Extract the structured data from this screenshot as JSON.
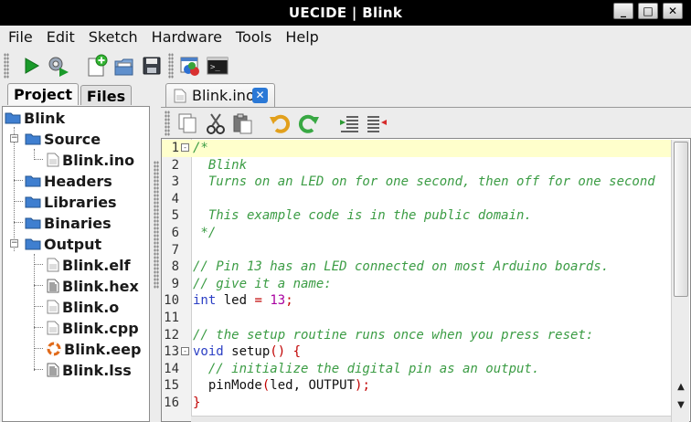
{
  "window": {
    "title": "UECIDE | Blink",
    "min_glyph": "_",
    "max_glyph": "□",
    "close_glyph": "✕"
  },
  "menu": [
    "File",
    "Edit",
    "Sketch",
    "Hardware",
    "Tools",
    "Help"
  ],
  "toolbar_icons": [
    "run-icon",
    "program-icon",
    "new-file-icon",
    "open-file-icon",
    "save-icon",
    "board-manager-icon",
    "serial-terminal-icon"
  ],
  "left_tabs": {
    "project": "Project",
    "files": "Files"
  },
  "tree": [
    {
      "label": "Blink",
      "icon": "folder-icon"
    },
    {
      "label": "Source",
      "icon": "folder-icon"
    },
    {
      "label": "Blink.ino",
      "icon": "file-icon"
    },
    {
      "label": "Headers",
      "icon": "folder-icon"
    },
    {
      "label": "Libraries",
      "icon": "folder-icon"
    },
    {
      "label": "Binaries",
      "icon": "folder-icon"
    },
    {
      "label": "Output",
      "icon": "folder-icon"
    },
    {
      "label": "Blink.elf",
      "icon": "file-icon"
    },
    {
      "label": "Blink.hex",
      "icon": "hex-file-icon"
    },
    {
      "label": "Blink.o",
      "icon": "file-icon"
    },
    {
      "label": "Blink.cpp",
      "icon": "file-icon"
    },
    {
      "label": "Blink.eep",
      "icon": "eeprom-file-icon"
    },
    {
      "label": "Blink.lss",
      "icon": "hex-file-icon"
    }
  ],
  "editor_tab": {
    "name": "Blink.ino",
    "close_glyph": "✕"
  },
  "editor_toolbar_icons": [
    "copy-icon",
    "cut-icon",
    "paste-icon",
    "undo-icon",
    "redo-icon",
    "indent-icon",
    "outdent-icon"
  ],
  "code_lines": [
    {
      "n": "1",
      "tokens": [
        [
          "cm",
          "/*"
        ]
      ],
      "fold": "-"
    },
    {
      "n": "2",
      "tokens": [
        [
          "cm",
          "  Blink"
        ]
      ]
    },
    {
      "n": "3",
      "tokens": [
        [
          "cm",
          "  Turns on an LED on for one second, then off for one second"
        ]
      ]
    },
    {
      "n": "4",
      "tokens": []
    },
    {
      "n": "5",
      "tokens": [
        [
          "cm",
          "  This example code is in the public domain."
        ]
      ]
    },
    {
      "n": "6",
      "tokens": [
        [
          "cm",
          " */"
        ]
      ]
    },
    {
      "n": "7",
      "tokens": []
    },
    {
      "n": "8",
      "tokens": [
        [
          "cm",
          "// Pin 13 has an LED connected on most Arduino boards."
        ]
      ]
    },
    {
      "n": "9",
      "tokens": [
        [
          "cm",
          "// give it a name:"
        ]
      ]
    },
    {
      "n": "10",
      "tokens": [
        [
          "kw",
          "int"
        ],
        [
          "id",
          " led "
        ],
        [
          "pn",
          "="
        ],
        [
          "id",
          " "
        ],
        [
          "num",
          "13"
        ],
        [
          "pn",
          ";"
        ]
      ]
    },
    {
      "n": "11",
      "tokens": []
    },
    {
      "n": "12",
      "tokens": [
        [
          "cm",
          "// the setup routine runs once when you press reset:"
        ]
      ]
    },
    {
      "n": "13",
      "tokens": [
        [
          "kw",
          "void"
        ],
        [
          "id",
          " setup"
        ],
        [
          "pn",
          "()"
        ],
        [
          "id",
          " "
        ],
        [
          "pn",
          "{"
        ]
      ],
      "fold": "-"
    },
    {
      "n": "14",
      "tokens": [
        [
          "cm",
          "  // initialize the digital pin as an output."
        ]
      ]
    },
    {
      "n": "15",
      "tokens": [
        [
          "id",
          "  pinMode"
        ],
        [
          "pn",
          "("
        ],
        [
          "id",
          "led, OUTPUT"
        ],
        [
          "pn",
          ")"
        ],
        [
          "pn",
          ";"
        ]
      ]
    },
    {
      "n": "16",
      "tokens": [
        [
          "pn",
          "}"
        ]
      ]
    }
  ],
  "colors": {
    "comment": "#3b9c44",
    "keyword": "#2b3fc4",
    "number": "#a800a0",
    "punct": "#c00000",
    "current_line": "#ffffcc"
  }
}
